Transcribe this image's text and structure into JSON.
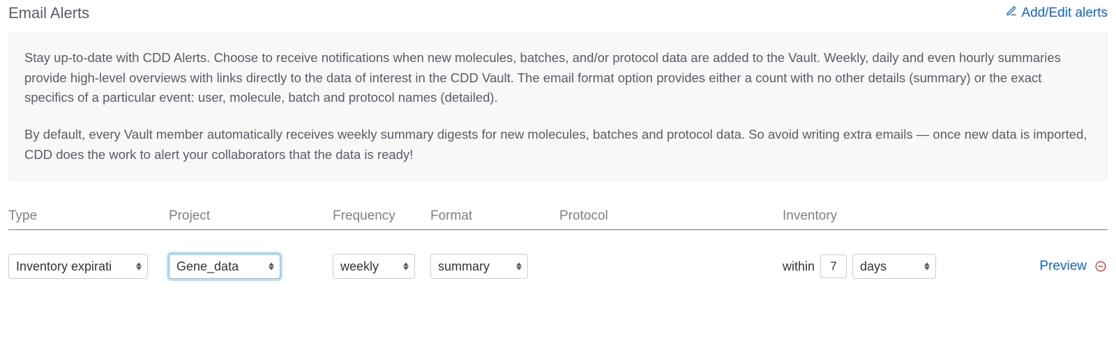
{
  "header": {
    "title": "Email Alerts",
    "add_edit_label": "Add/Edit alerts"
  },
  "info": {
    "paragraph1": "Stay up-to-date with CDD Alerts. Choose to receive notifications when new molecules, batches, and/or protocol data are added to the Vault. Weekly, daily and even hourly summaries provide high-level overviews with links directly to the data of interest in the CDD Vault. The email format option provides either a count with no other details (summary) or the exact specifics of a particular event: user, molecule, batch and protocol names (detailed).",
    "paragraph2": "By default, every Vault member automatically receives weekly summary digests for new molecules, batches and protocol data. So avoid writing extra emails — once new data is imported, CDD does the work to alert your collaborators that the data is ready!"
  },
  "columns": {
    "type": "Type",
    "project": "Project",
    "frequency": "Frequency",
    "format": "Format",
    "protocol": "Protocol",
    "inventory": "Inventory"
  },
  "row": {
    "type": "Inventory expirati",
    "project": "Gene_data",
    "frequency": "weekly",
    "format": "summary",
    "protocol": "",
    "inventory": {
      "prefix": "within",
      "value": "7",
      "unit": "days"
    },
    "preview_label": "Preview"
  }
}
